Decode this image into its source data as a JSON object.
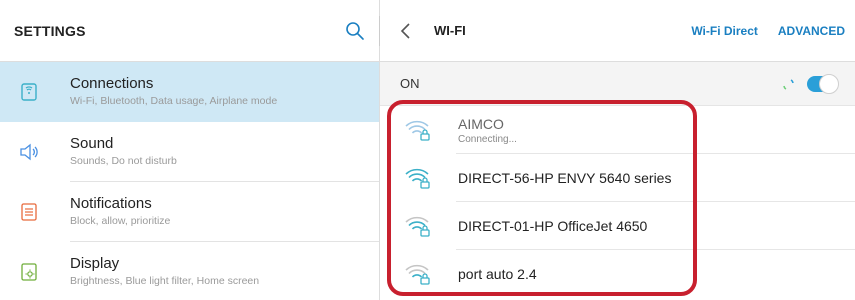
{
  "left_panel": {
    "title": "SETTINGS",
    "items": [
      {
        "label": "Connections",
        "sub": "Wi-Fi, Bluetooth, Data usage, Airplane mode",
        "icon": "connections-icon"
      },
      {
        "label": "Sound",
        "sub": "Sounds, Do not disturb",
        "icon": "sound-icon"
      },
      {
        "label": "Notifications",
        "sub": "Block, allow, prioritize",
        "icon": "notifications-icon"
      },
      {
        "label": "Display",
        "sub": "Brightness, Blue light filter, Home screen",
        "icon": "display-icon"
      }
    ]
  },
  "right_panel": {
    "title": "WI-FI",
    "wifi_direct": "Wi-Fi Direct",
    "advanced": "ADVANCED",
    "status_label": "ON",
    "networks": [
      {
        "name": "AIMCO",
        "status": "Connecting..."
      },
      {
        "name": "DIRECT-56-HP ENVY 5640 series"
      },
      {
        "name": "DIRECT-01-HP OfficeJet 4650"
      },
      {
        "name": "port auto 2.4"
      }
    ]
  },
  "colors": {
    "accent": "#2a9fd8",
    "link": "#1a7fc1",
    "active_bg": "#cfe8f5",
    "highlight": "#c8202e",
    "icon_teal": "#3bb0c8",
    "icon_orange": "#e86a3c",
    "icon_blue": "#4a90e2",
    "icon_green": "#6fae3a"
  }
}
